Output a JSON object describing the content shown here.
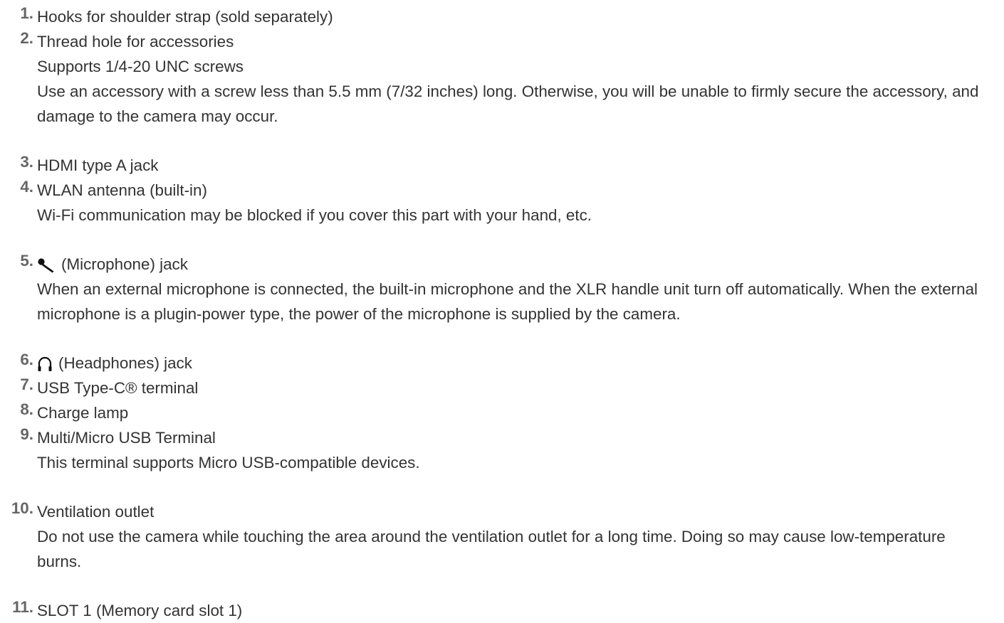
{
  "items": [
    {
      "num": "1.",
      "title": "Hooks for shoulder strap (sold separately)"
    },
    {
      "num": "2.",
      "title": "Thread hole for accessories",
      "lines": [
        "Supports 1/4-20 UNC screws"
      ],
      "para": "Use an accessory with a screw less than 5.5 mm (7/32 inches) long. Otherwise, you will be unable to firmly secure the accessory, and damage to the camera may occur."
    },
    {
      "num": "3.",
      "title": "HDMI type A jack"
    },
    {
      "num": "4.",
      "title": "WLAN antenna (built-in)",
      "para": "Wi-Fi communication may be blocked if you cover this part with your hand, etc."
    },
    {
      "num": "5.",
      "icon": "microphone-icon",
      "title": "(Microphone) jack",
      "para": "When an external microphone is connected, the built-in microphone and the XLR handle unit turn off automatically. When the external microphone is a plugin-power type, the power of the microphone is supplied by the camera."
    },
    {
      "num": "6.",
      "icon": "headphones-icon",
      "title": "(Headphones) jack"
    },
    {
      "num": "7.",
      "title": "USB Type-C® terminal"
    },
    {
      "num": "8.",
      "title": "Charge lamp"
    },
    {
      "num": "9.",
      "title": "Multi/Micro USB Terminal",
      "para": "This terminal supports Micro USB-compatible devices."
    },
    {
      "num": "10.",
      "title": "Ventilation outlet",
      "para": "Do not use the camera while touching the area around the ventilation outlet for a long time. Doing so may cause low-temperature burns."
    },
    {
      "num": "11.",
      "title": "SLOT 1 (Memory card slot 1)"
    }
  ]
}
